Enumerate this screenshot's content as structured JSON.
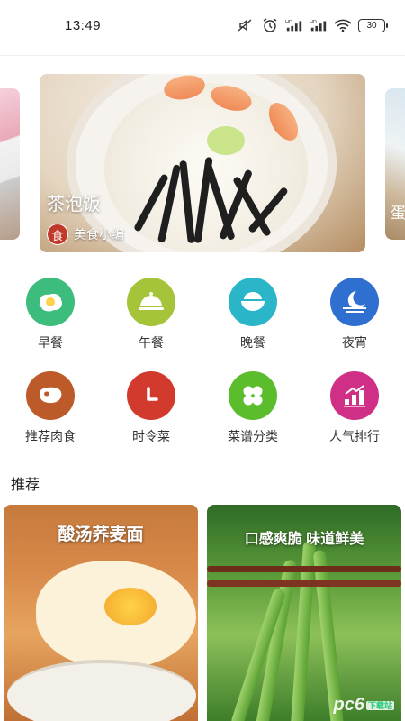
{
  "status_bar": {
    "time": "13:49",
    "battery": "30",
    "icons": [
      "mute-icon",
      "alarm-icon",
      "hd-signal-icon",
      "hd-signal-icon",
      "wifi-icon",
      "battery-icon"
    ]
  },
  "banner": {
    "title": "茶泡饭",
    "author": "美食小编",
    "author_avatar_text": "食",
    "next_title_fragment": "蛋"
  },
  "categories": [
    {
      "label": "早餐",
      "icon": "fried-egg-icon",
      "color": "#3dbd7d"
    },
    {
      "label": "午餐",
      "icon": "food-cloche-icon",
      "color": "#a5c43a"
    },
    {
      "label": "晚餐",
      "icon": "bowl-icon",
      "color": "#2ab5c9"
    },
    {
      "label": "夜宵",
      "icon": "moon-icon",
      "color": "#2f6fd0"
    },
    {
      "label": "推荐肉食",
      "icon": "meat-icon",
      "color": "#bd5a2a"
    },
    {
      "label": "时令菜",
      "icon": "clock-icon",
      "color": "#d23a2e"
    },
    {
      "label": "菜谱分类",
      "icon": "grid-flower-icon",
      "color": "#5bbd2b"
    },
    {
      "label": "人气排行",
      "icon": "bar-chart-icon",
      "color": "#d02f86"
    }
  ],
  "recommend": {
    "section_title": "推荐",
    "cards": [
      {
        "title": "酸汤荞麦面"
      },
      {
        "title": "口感爽脆 味道鲜美"
      }
    ],
    "watermark": "pc6",
    "watermark_sub": "下载站"
  }
}
